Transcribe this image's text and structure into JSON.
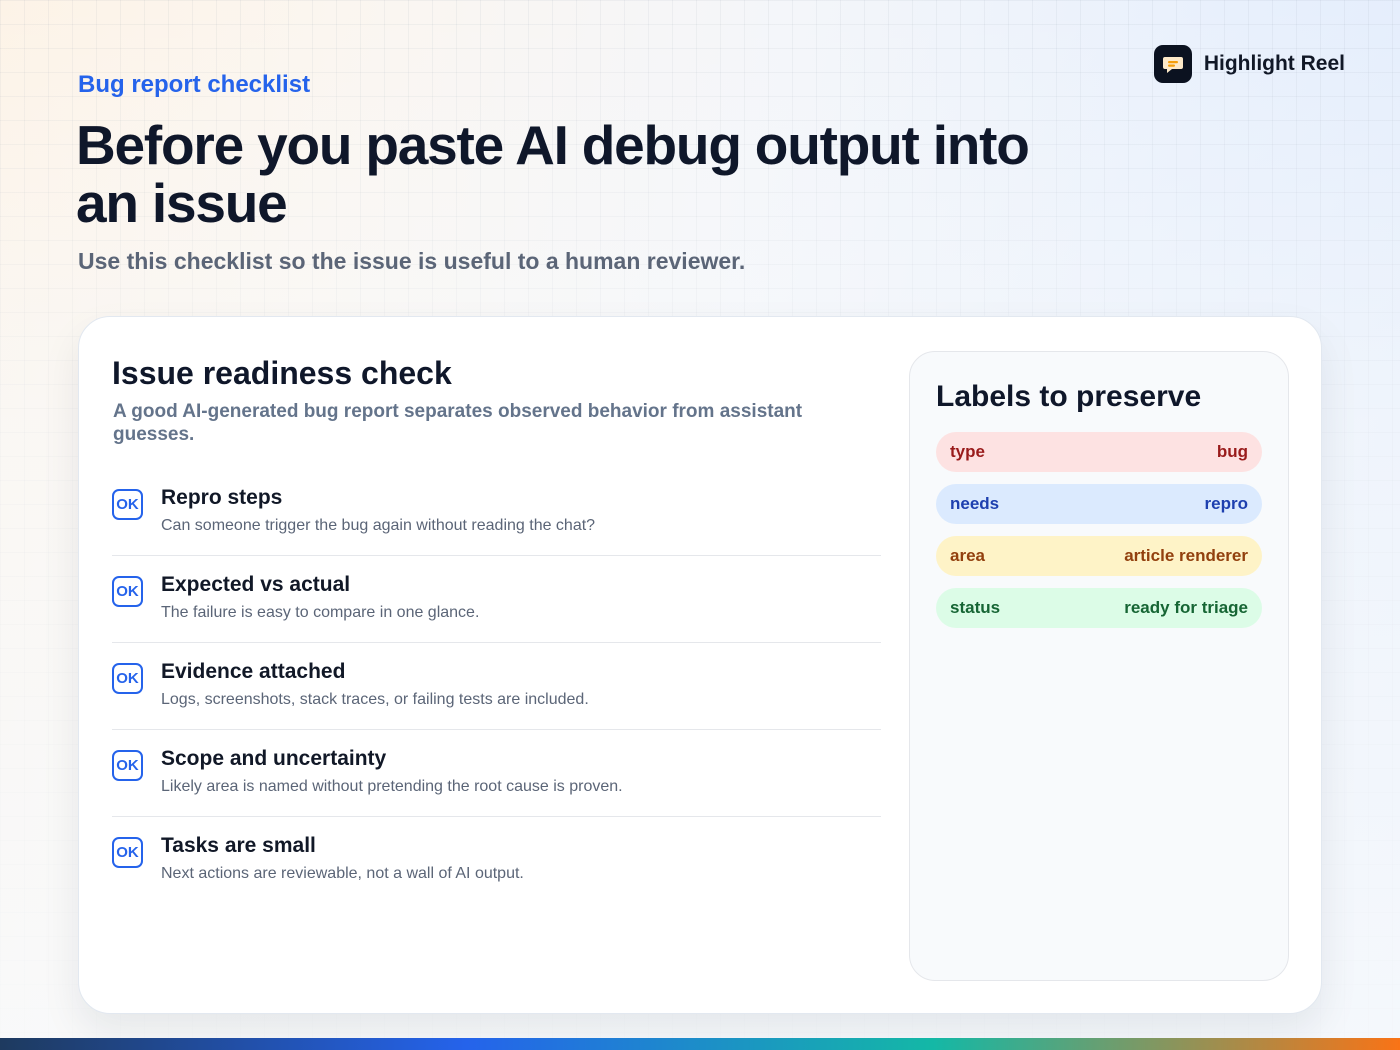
{
  "header": {
    "eyebrow": "Bug report checklist",
    "title": "Before you paste AI debug output into an issue",
    "subtitle": "Use this checklist so the issue is useful to a human reviewer."
  },
  "brand": {
    "name": "Highlight Reel",
    "icon": "chat-bubble-icon"
  },
  "card": {
    "title": "Issue readiness check",
    "description": "A good AI-generated bug report separates observed behavior from assistant guesses.",
    "items": [
      {
        "badge": "OK",
        "title": "Repro steps",
        "description": "Can someone trigger the bug again without reading the chat?"
      },
      {
        "badge": "OK",
        "title": "Expected vs actual",
        "description": "The failure is easy to compare in one glance."
      },
      {
        "badge": "OK",
        "title": "Evidence attached",
        "description": "Logs, screenshots, stack traces, or failing tests are included."
      },
      {
        "badge": "OK",
        "title": "Scope and uncertainty",
        "description": "Likely area is named without pretending the root cause is proven."
      },
      {
        "badge": "OK",
        "title": "Tasks are small",
        "description": "Next actions are reviewable, not a wall of AI output."
      }
    ]
  },
  "labels_panel": {
    "title": "Labels to preserve",
    "labels": [
      {
        "key": "type",
        "value": "bug",
        "bg": "#fde2e2",
        "color": "#991b1b"
      },
      {
        "key": "needs",
        "value": "repro",
        "bg": "#dbeafe",
        "color": "#1e40af"
      },
      {
        "key": "area",
        "value": "article renderer",
        "bg": "#fef3c7",
        "color": "#92400e"
      },
      {
        "key": "status",
        "value": "ready for triage",
        "bg": "#dcfce7",
        "color": "#166534"
      }
    ]
  },
  "colors": {
    "accent": "#2563eb",
    "bottom_bar": [
      "#1e3a5f",
      "#2563eb",
      "#14b8a6",
      "#f97316"
    ]
  }
}
